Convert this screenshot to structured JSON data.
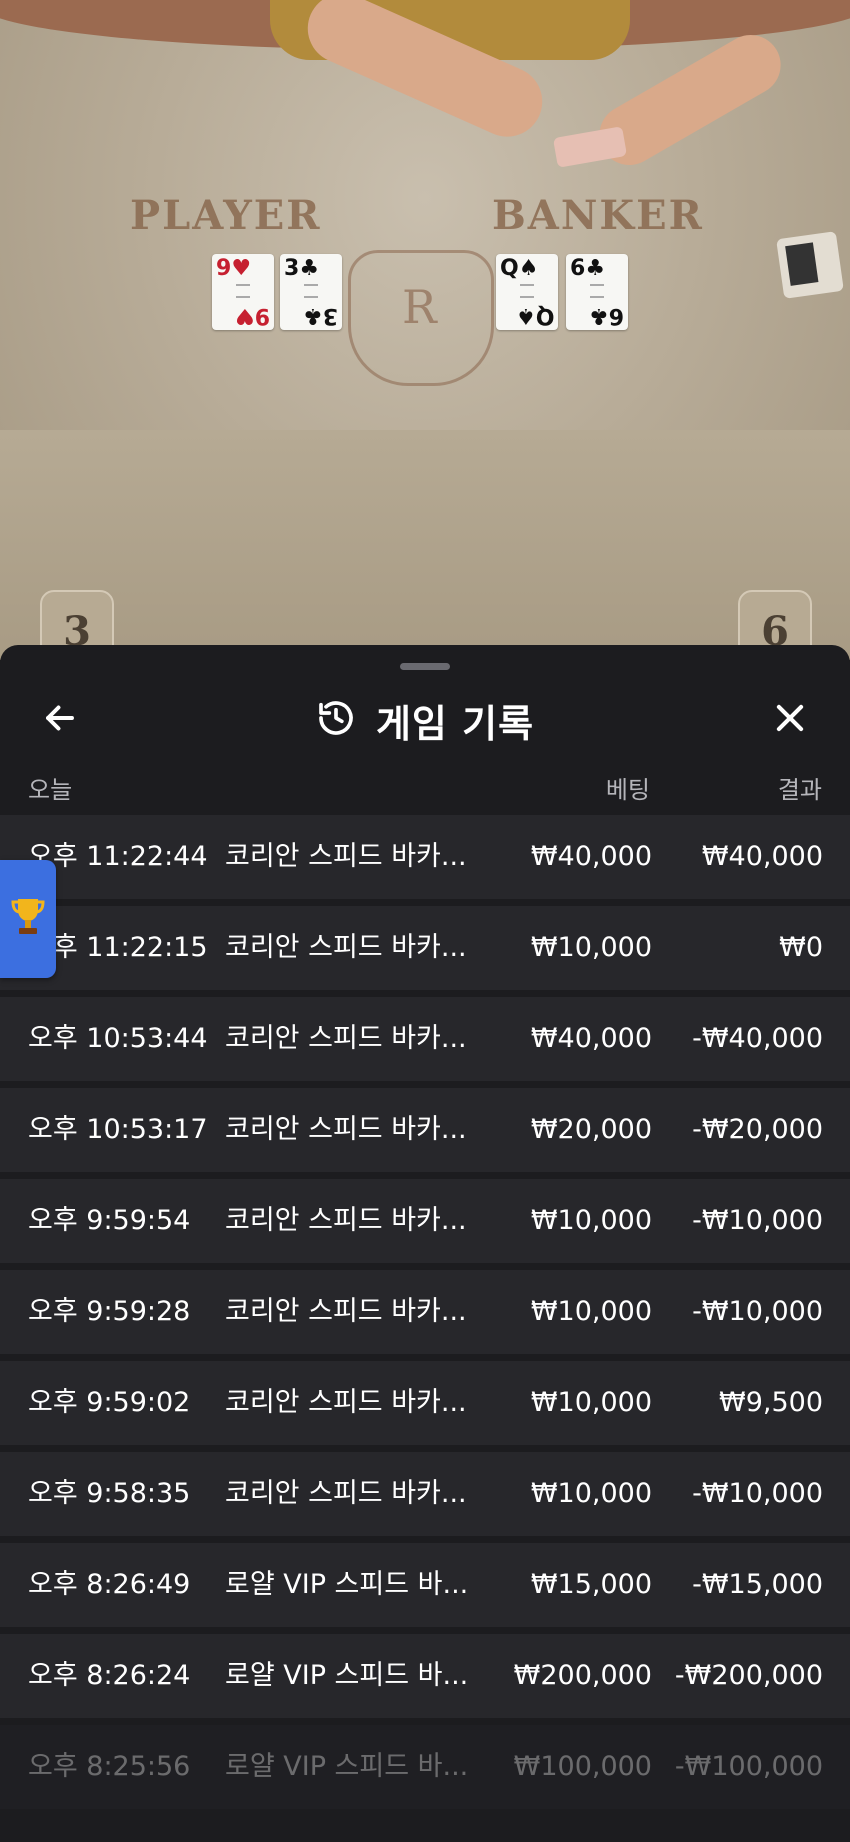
{
  "table": {
    "player_label": "PLAYER",
    "banker_label": "BANKER",
    "crest_letter": "R",
    "player_cards": [
      {
        "rank": "9",
        "suit": "♥",
        "color": "red"
      },
      {
        "rank": "3",
        "suit": "♣",
        "color": "blk"
      }
    ],
    "banker_cards": [
      {
        "rank": "Q",
        "suit": "♠",
        "color": "blk"
      },
      {
        "rank": "6",
        "suit": "♣",
        "color": "blk"
      }
    ],
    "seat_left": "3",
    "seat_right": "6"
  },
  "sheet": {
    "title": "게임 기록",
    "history_icon": "history-icon",
    "back_icon": "arrow-left-icon",
    "close_icon": "close-icon",
    "columns": {
      "today": "오늘",
      "bet": "베팅",
      "result": "결과"
    },
    "rows": [
      {
        "time": "오후 11:22:44",
        "game": "코리안 스피드 바카...",
        "bet": "₩40,000",
        "result": "₩40,000"
      },
      {
        "time": "오후 11:22:15",
        "game": "코리안 스피드 바카...",
        "bet": "₩10,000",
        "result": "₩0"
      },
      {
        "time": "오후 10:53:44",
        "game": "코리안 스피드 바카...",
        "bet": "₩40,000",
        "result": "-₩40,000"
      },
      {
        "time": "오후 10:53:17",
        "game": "코리안 스피드 바카...",
        "bet": "₩20,000",
        "result": "-₩20,000"
      },
      {
        "time": "오후 9:59:54",
        "game": "코리안 스피드 바카...",
        "bet": "₩10,000",
        "result": "-₩10,000"
      },
      {
        "time": "오후 9:59:28",
        "game": "코리안 스피드 바카...",
        "bet": "₩10,000",
        "result": "-₩10,000"
      },
      {
        "time": "오후 9:59:02",
        "game": "코리안 스피드 바카...",
        "bet": "₩10,000",
        "result": "₩9,500"
      },
      {
        "time": "오후 9:58:35",
        "game": "코리안 스피드 바카...",
        "bet": "₩10,000",
        "result": "-₩10,000"
      },
      {
        "time": "오후 8:26:49",
        "game": "로얄 VIP 스피드 바...",
        "bet": "₩15,000",
        "result": "-₩15,000"
      },
      {
        "time": "오후 8:26:24",
        "game": "로얄 VIP 스피드 바...",
        "bet": "₩200,000",
        "result": "-₩200,000"
      },
      {
        "time": "오후 8:25:56",
        "game": "로얄 VIP 스피드 바...",
        "bet": "₩100,000",
        "result": "-₩100,000"
      }
    ]
  },
  "trophy_tab": {
    "icon": "trophy-icon",
    "color": "#3c6fe0"
  }
}
